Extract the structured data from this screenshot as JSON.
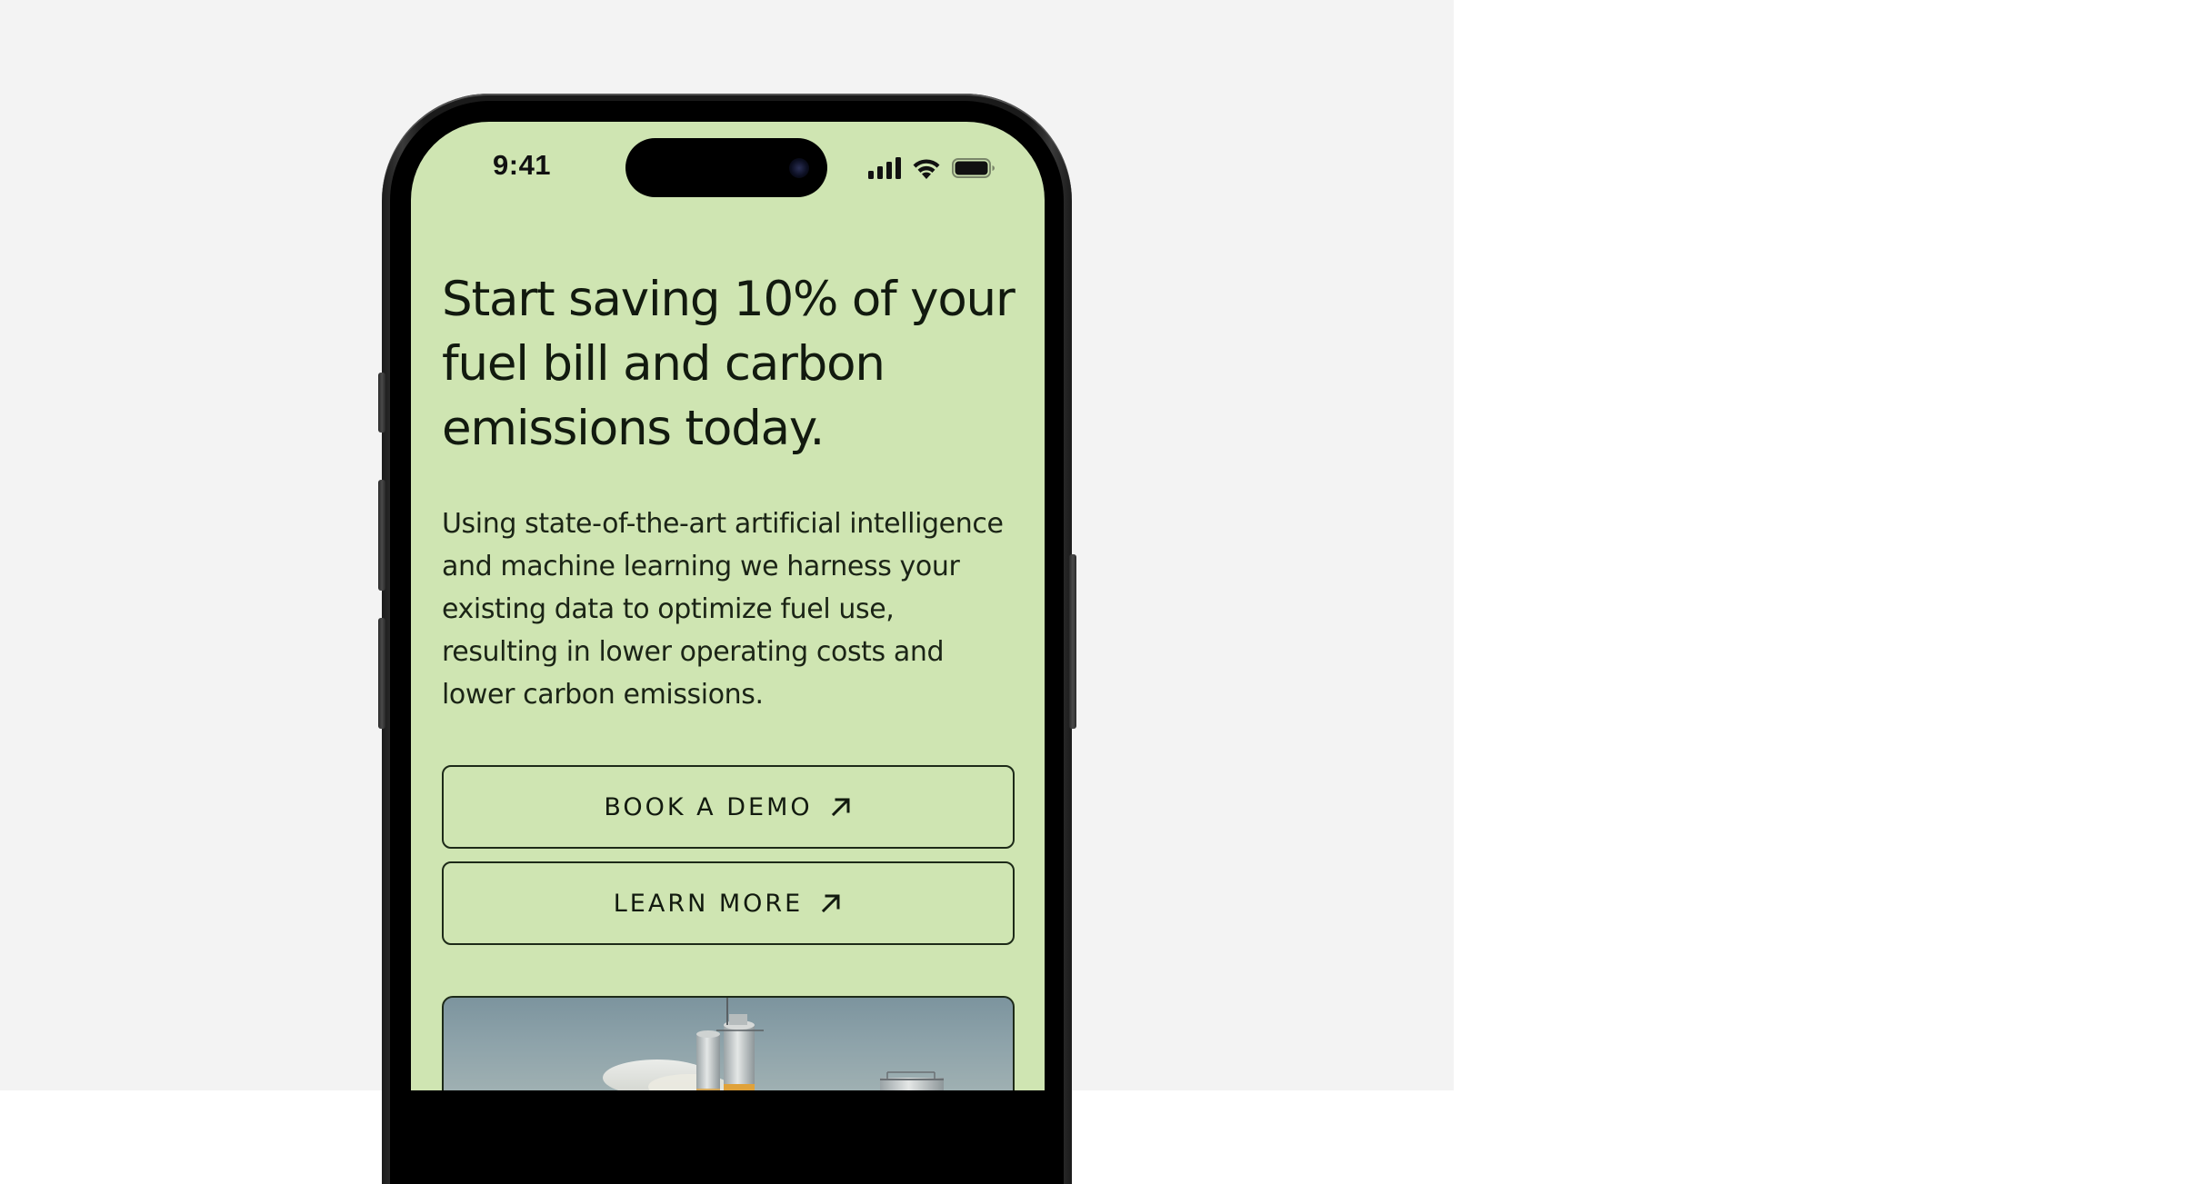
{
  "status_bar": {
    "time": "9:41",
    "icons": [
      "cellular-signal-icon",
      "wifi-icon",
      "battery-icon"
    ]
  },
  "hero": {
    "headline": "Start saving 10% of your fuel bill and carbon emissions today.",
    "body": "Using state-of-the-art artificial intelligence and machine learning we harness your existing data to optimize fuel use, resulting in lower operating costs and lower carbon emissions."
  },
  "buttons": {
    "book_demo": {
      "label": "BOOK A DEMO",
      "icon": "arrow-up-right-icon"
    },
    "learn_more": {
      "label": "LEARN MORE",
      "icon": "arrow-up-right-icon"
    }
  },
  "image": {
    "subject": "industrial silos under sky"
  },
  "colors": {
    "screen_background": "#cfe5b2",
    "text": "#121a0f",
    "canvas_left": "#f3f3f3",
    "canvas_right": "#ffffff",
    "phone_frame": "#1a1a1a"
  }
}
